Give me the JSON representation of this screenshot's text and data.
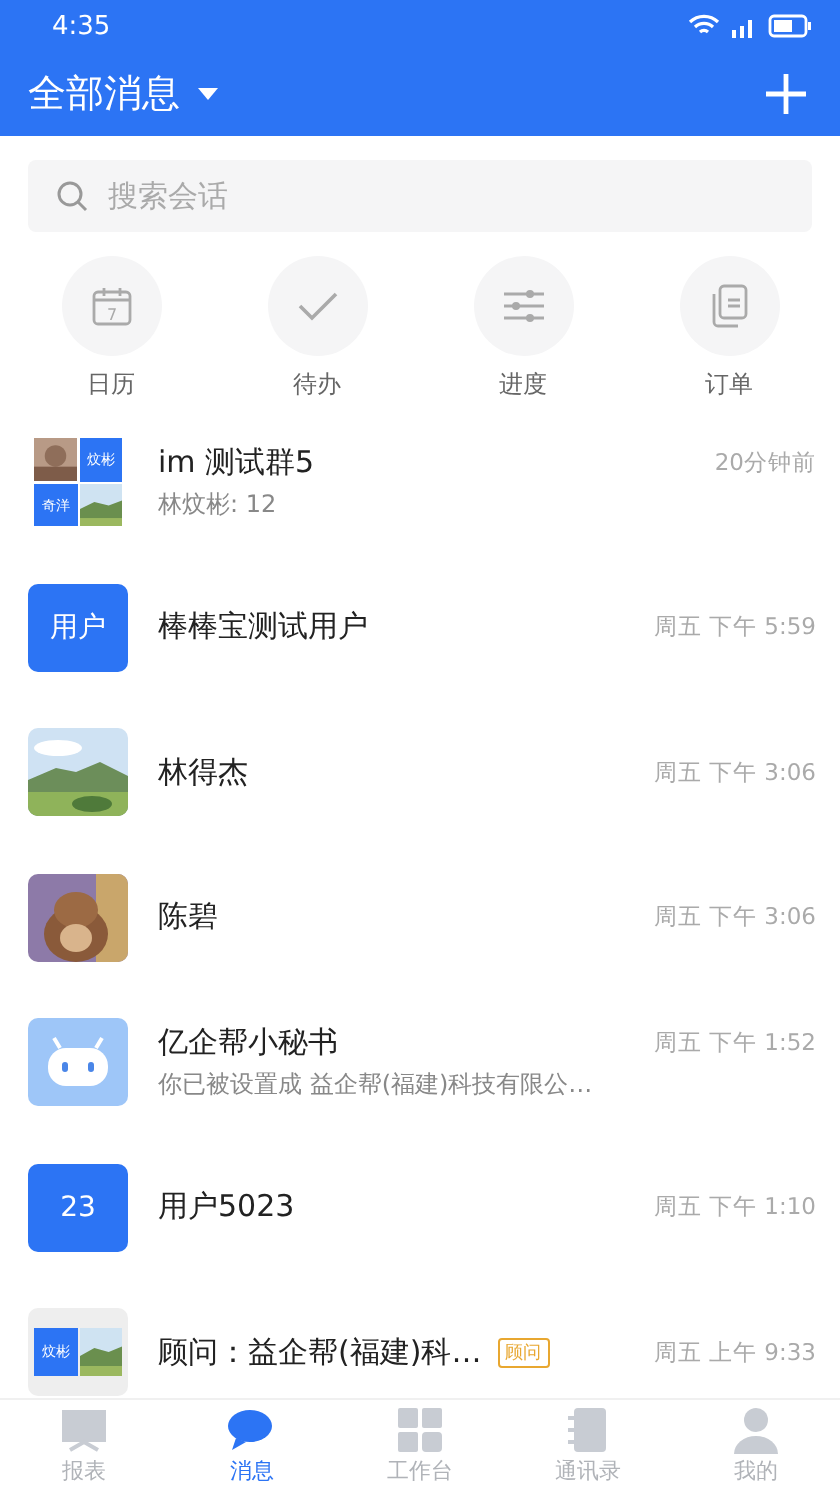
{
  "status_bar": {
    "time": "4:35"
  },
  "header": {
    "title": "全部消息"
  },
  "search": {
    "placeholder": "搜索会话"
  },
  "shortcuts": [
    {
      "label": "日历",
      "kind": "calendar",
      "day": "7"
    },
    {
      "label": "待办",
      "kind": "check"
    },
    {
      "label": "进度",
      "kind": "sliders"
    },
    {
      "label": "订单",
      "kind": "docs"
    }
  ],
  "conversations": [
    {
      "name": "im 测试群5",
      "preview": "林炆彬: 12",
      "time": "20分钟前",
      "avatar": {
        "kind": "group",
        "labels": [
          "炆彬",
          "奇洋"
        ]
      }
    },
    {
      "name": "棒棒宝测试用户",
      "time": "周五 下午 5:59",
      "avatar": {
        "kind": "text",
        "text": "用户"
      }
    },
    {
      "name": "林得杰",
      "time": "周五 下午 3:06"
    },
    {
      "name": "陈碧",
      "time": "周五 下午 3:06"
    },
    {
      "name": "亿企帮小秘书",
      "preview": "你已被设置成 益企帮(福建)科技有限公…",
      "time": "周五 下午 1:52",
      "avatar": {
        "kind": "bot"
      }
    },
    {
      "name": "用户5023",
      "time": "周五 下午 1:10",
      "avatar": {
        "kind": "text",
        "text": "23"
      }
    },
    {
      "name": "顾问：益企帮(福建)科…",
      "badge": "顾问",
      "time": "周五 上午 9:33",
      "avatar": {
        "kind": "pair",
        "labels": [
          "炆彬"
        ]
      }
    }
  ],
  "tabs": [
    {
      "label": "报表",
      "kind": "chart",
      "selected": false
    },
    {
      "label": "消息",
      "kind": "chat",
      "selected": true
    },
    {
      "label": "工作台",
      "kind": "grid",
      "selected": false
    },
    {
      "label": "通讯录",
      "kind": "book",
      "selected": false
    },
    {
      "label": "我的",
      "kind": "person",
      "selected": false
    }
  ]
}
